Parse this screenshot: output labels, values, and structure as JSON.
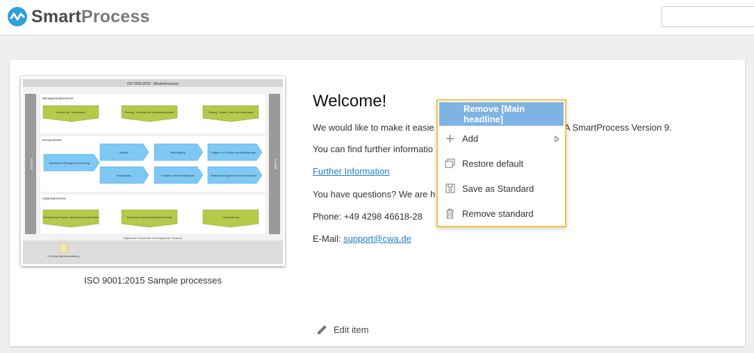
{
  "header": {
    "brand_part1": "Smart",
    "brand_part2": "Process",
    "search_placeholder": ""
  },
  "tile": {
    "caption": "ISO 9001:2015 Sample processes",
    "diagram": {
      "title": "ISO 9001:2015 - Masterprozesse",
      "left_band": "KUNDE",
      "right_band": "KUNDE",
      "sections": [
        {
          "label": "Managementprozesse"
        },
        {
          "label": "Kernprozesse"
        },
        {
          "label": "Supportprozesse"
        }
      ],
      "management_boxes": [
        "Kontext der Organisation",
        "Führung - Strategie und Verantwortlichkeiten",
        "Planung - Risiken, Ziele und Änderungen"
      ],
      "core_boxes": [
        "Betriebliche Planung und Steuerung",
        "Vertrieb",
        "Beschaffung",
        "Freigabe von Produkten und Dienstleistungen",
        "Entwicklung",
        "Produktion und Dienstleistungen",
        "Nichtkonforme Ergebnisse und Kundenservice"
      ],
      "support_boxes": [
        "Unterstützung: Personal, Infrastruktur und Information",
        "Bewertung: Kundenzufriedenheit und Audit",
        "Verbesserung"
      ],
      "footer_label": "Mitgeltende Dokumente und eingesetzte Prozesse",
      "doc_label": "01-01-Mat Systembeschreibung"
    }
  },
  "welcome": {
    "title": "Welcome!",
    "line1": "We would like to make it easie",
    "line1_tail": "A SmartProcess Version 9.",
    "line2": "You can find further informatio",
    "link": "Further Information",
    "line3": "You have questions? We are h",
    "phone": "Phone: +49 4298 46618-28",
    "email_label": "E-Mail: ",
    "email": "support@cwa.de"
  },
  "edit": {
    "label": "Edit item"
  },
  "context_menu": {
    "header": "Remove [Main headline]",
    "items": [
      {
        "label": "Add",
        "icon": "plus-icon",
        "submenu": true
      },
      {
        "label": "Restore default",
        "icon": "restore-icon"
      },
      {
        "label": "Save as Standard",
        "icon": "save-icon"
      },
      {
        "label": "Remove standard",
        "icon": "trash-icon"
      }
    ]
  },
  "colors": {
    "accent": "#1e7ec8",
    "menu_header": "#7fb3e3",
    "menu_border": "#f2c53d",
    "diagram_green": "#b5c94a",
    "diagram_blue": "#7dc8f5"
  }
}
